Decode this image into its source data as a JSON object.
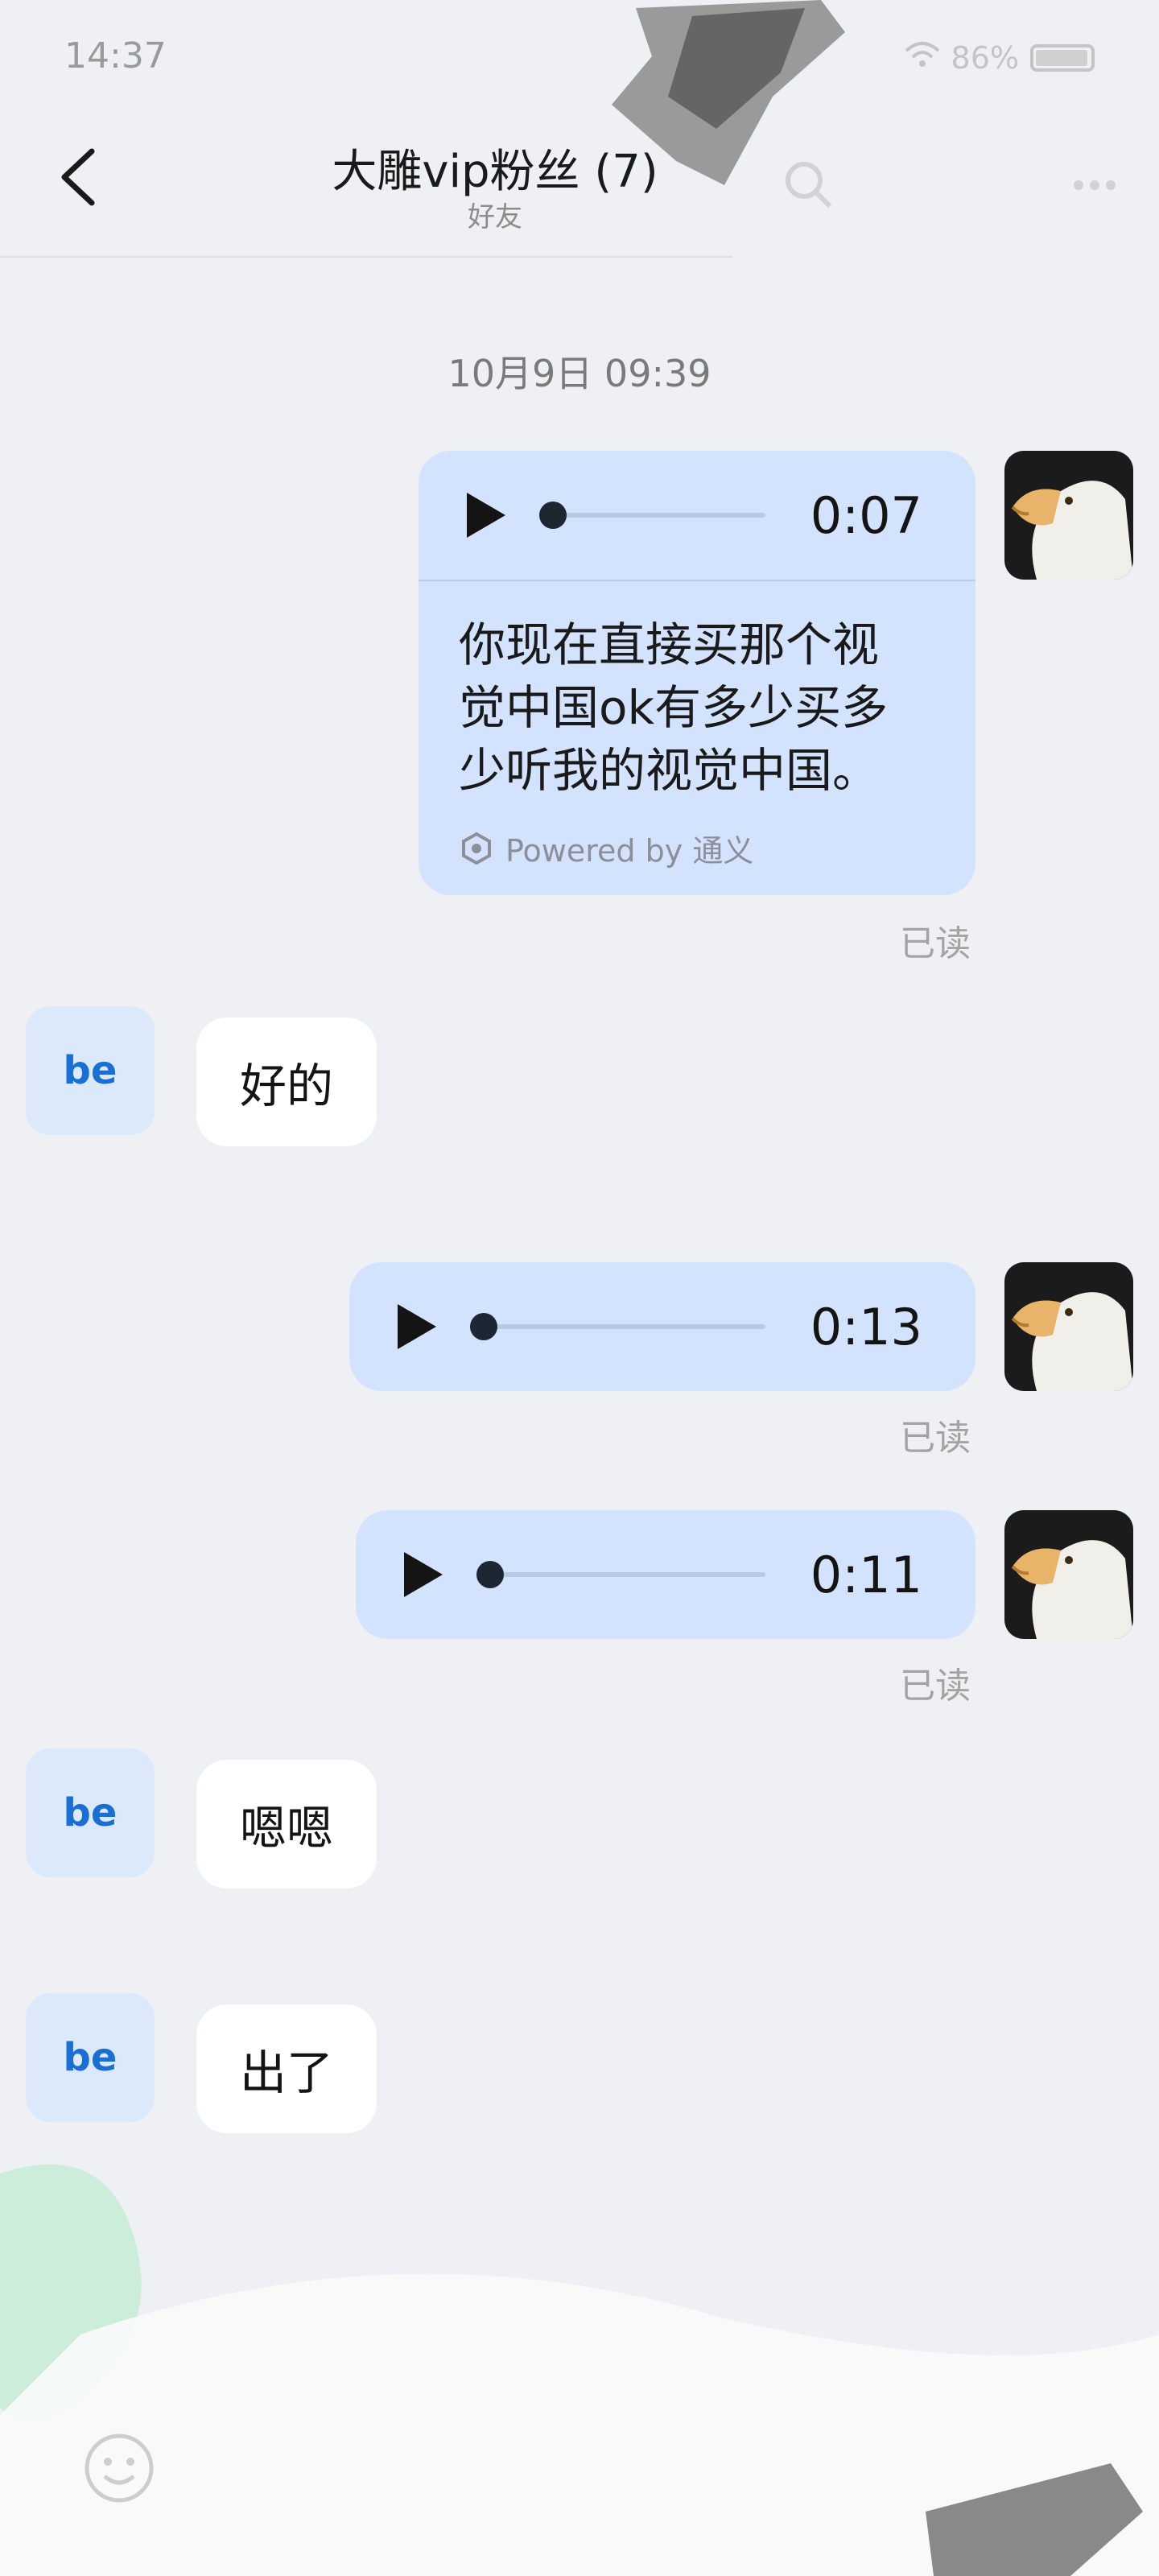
{
  "status_bar": {
    "time": "14:37",
    "battery": "86%"
  },
  "header": {
    "title": "大雕vip粉丝 (7)",
    "subtitle": "好友"
  },
  "chat": {
    "timestamp": "10月9日 09:39",
    "read_label": "已读",
    "messages": [
      {
        "duration": "0:07",
        "transcript": [
          "你现在直接买那个视",
          "觉中国ok有多少买多",
          "少听我的视觉中国。"
        ],
        "powered_by": "Powered by 通义"
      },
      {
        "sender": "be",
        "text": "好的"
      },
      {
        "duration": "0:13"
      },
      {
        "duration": "0:11"
      },
      {
        "sender": "be",
        "text": "嗯嗯"
      },
      {
        "sender": "be",
        "text": "出了"
      }
    ]
  },
  "icons": [
    "back-arrow-icon",
    "search-icon",
    "more-icon",
    "emoji-icon",
    "tongyi-logo-icon",
    "wifi-icon",
    "battery-icon"
  ]
}
